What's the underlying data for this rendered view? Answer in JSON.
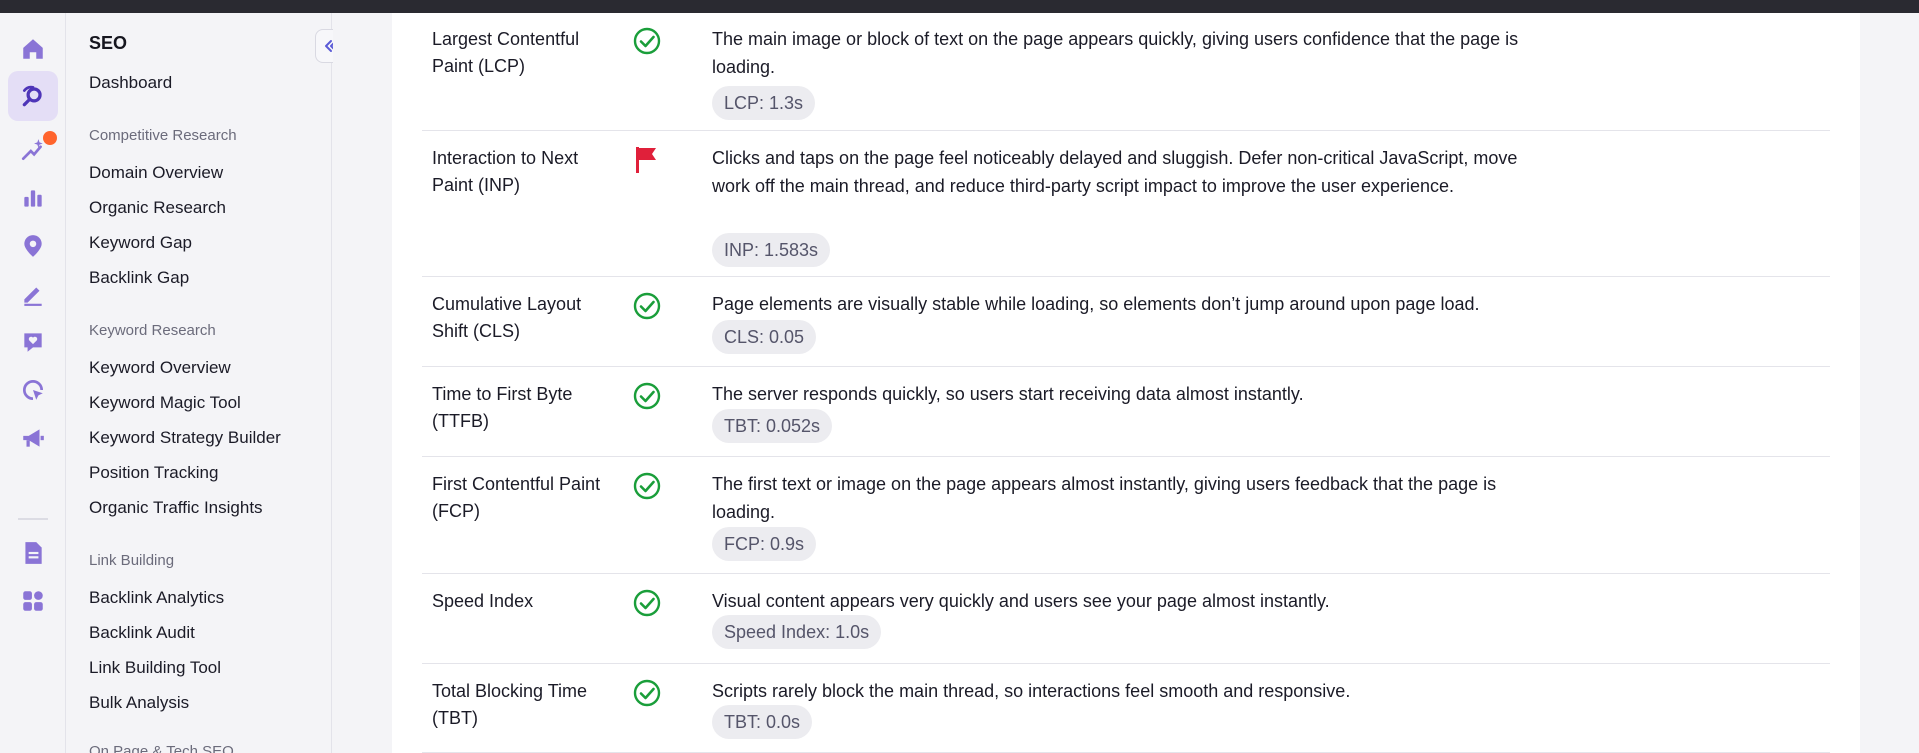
{
  "rail": {
    "items": [
      {
        "name": "home-icon"
      },
      {
        "name": "seo-icon"
      },
      {
        "name": "ai-sparkle-icon"
      },
      {
        "name": "bar-chart-icon"
      },
      {
        "name": "location-pin-icon"
      },
      {
        "name": "content-pencil-icon"
      },
      {
        "name": "heart-chat-icon"
      },
      {
        "name": "target-cursor-icon"
      },
      {
        "name": "megaphone-icon"
      },
      {
        "name": "report-document-icon"
      },
      {
        "name": "apps-grid-icon"
      }
    ],
    "accent_color": "#6a4fcf",
    "badge_color": "#ff642d"
  },
  "sidebar": {
    "title": "SEO",
    "dashboard": "Dashboard",
    "sections": [
      {
        "title": "Competitive Research",
        "items": [
          "Domain Overview",
          "Organic Research",
          "Keyword Gap",
          "Backlink Gap"
        ]
      },
      {
        "title": "Keyword Research",
        "items": [
          "Keyword Overview",
          "Keyword Magic Tool",
          "Keyword Strategy Builder",
          "Position Tracking",
          "Organic Traffic Insights"
        ]
      },
      {
        "title": "Link Building",
        "items": [
          "Backlink Analytics",
          "Backlink Audit",
          "Link Building Tool",
          "Bulk Analysis"
        ]
      },
      {
        "title": "On Page & Tech SEO",
        "items": []
      }
    ],
    "collapse_icon": "double-chevron-left-icon"
  },
  "metrics": [
    {
      "name": "Largest Contentful Paint (LCP)",
      "status": "good",
      "description": "The main image or block of text on the page appears quickly, giving users confidence that the page is loading.",
      "value": "LCP: 1.3s"
    },
    {
      "name": "Interaction to Next Paint (INP)",
      "status": "poor",
      "description": "Clicks and taps on the page feel noticeably delayed and sluggish. Defer non-critical JavaScript, move work off the main thread, and reduce third-party script impact to improve the user experience.",
      "value": "INP: 1.583s"
    },
    {
      "name": "Cumulative Layout Shift (CLS)",
      "status": "good",
      "description": "Page elements are visually stable while loading, so elements don’t jump around upon page load.",
      "value": "CLS: 0.05"
    },
    {
      "name": "Time to First Byte (TTFB)",
      "status": "good",
      "description": "The server responds quickly, so users start receiving data almost instantly.",
      "value": "TBT: 0.052s"
    },
    {
      "name": "First Contentful Paint (FCP)",
      "status": "good",
      "description": "The first text or image on the page appears almost instantly, giving users feedback that the page is loading.",
      "value": "FCP: 0.9s"
    },
    {
      "name": "Speed Index",
      "status": "good",
      "description": "Visual content appears very quickly and users see your page almost instantly.",
      "value": "Speed Index: 1.0s"
    },
    {
      "name": "Total Blocking Time (TBT)",
      "status": "good",
      "description": "Scripts rarely block the main thread, so interactions feel smooth and responsive.",
      "value": "TBT: 0.0s"
    }
  ],
  "colors": {
    "good": "#1a9e3a",
    "poor": "#e0203a"
  }
}
